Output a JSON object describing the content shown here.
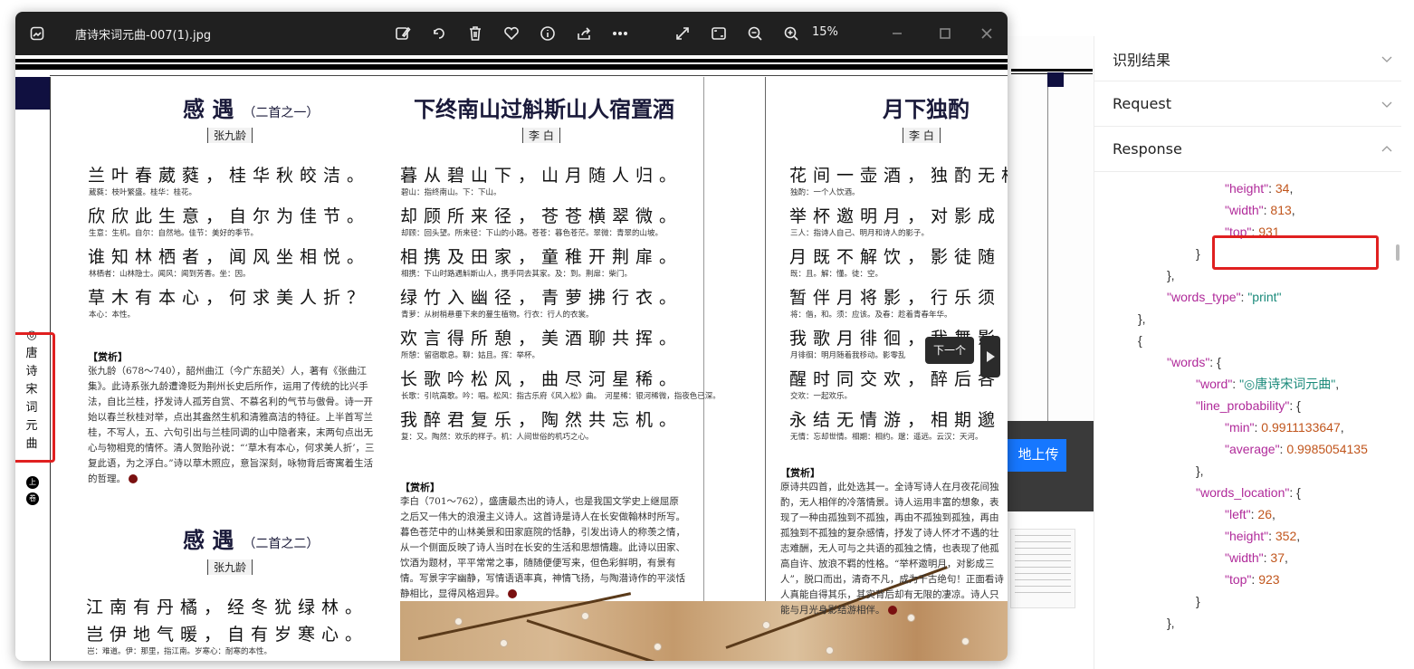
{
  "viewer": {
    "title": "唐诗宋词元曲-007(1).jpg",
    "zoom": "15%",
    "toolbar_icons": [
      "edit-image-icon",
      "rotate-icon",
      "delete-icon",
      "favorite-icon",
      "info-icon",
      "share-icon",
      "more-icon",
      "expand-icon",
      "fit-screen-icon",
      "zoom-out-icon",
      "zoom-in-icon"
    ],
    "tooltip": "下一个"
  },
  "page": {
    "side_label": [
      "◎",
      "唐",
      "诗",
      "宋",
      "词",
      "元",
      "曲"
    ],
    "side_tags": [
      "上",
      "卷"
    ],
    "poem1": {
      "title": "感 遇",
      "subtitle": "（二首之一）",
      "poet": "张九龄",
      "lines": [
        {
          "text": "兰叶春葳蕤，桂华秋皎洁。",
          "note": "葳蕤：枝叶繁盛。桂华：桂花。"
        },
        {
          "text": "欣欣此生意，自尔为佳节。",
          "note": "生意：生机。自尔：自然地。佳节：美好的季节。"
        },
        {
          "text": "谁知林栖者，闻风坐相悦。",
          "note": "林栖者：山林隐士。闻风：闻到芳香。坐：因。"
        },
        {
          "text": "草木有本心，何求美人折？",
          "note": "本心：本性。"
        }
      ],
      "analysis_heading": "【赏析】",
      "analysis": "张九龄（678～740），韶州曲江（今广东韶关）人，著有《张曲江集》。此诗系张九龄遭谗贬为荆州长史后所作，运用了传统的比兴手法，自比兰桂，抒发诗人孤芳自赏、不慕名利的气节与傲骨。诗一开始以春兰秋桂对举，点出其盎然生机和清雅高洁的特征。上半首写兰桂，不写人，五、六句引出与兰桂同调的山中隐者来，末两句点出无心与物相竞的情怀。清人贺贻孙说：“‘草木有本心，何求美人折’，三复此语，为之浮白。”诗以草木照应，意旨深刻，咏物背后寄寓着生活的哲理。"
    },
    "poem2": {
      "title": "感 遇",
      "subtitle": "（二首之二）",
      "poet": "张九龄",
      "lines": [
        {
          "text": "江南有丹橘，经冬犹绿林。",
          "note": ""
        },
        {
          "text": "岂伊地气暖，自有岁寒心。",
          "note": "岂：难道。伊：那里，指江南。岁寒心：耐寒的本性。"
        }
      ]
    },
    "poem3": {
      "title": "下终南山过斛斯山人宿置酒",
      "poet": "李 白",
      "lines": [
        {
          "text": "暮从碧山下，山月随人归。",
          "note": "碧山：指终南山。下：下山。"
        },
        {
          "text": "却顾所来径，苍苍横翠微。",
          "note": "却顾：回头望。所来径：下山的小路。苍苍：暮色苍茫。翠微：青翠的山坡。"
        },
        {
          "text": "相携及田家，童稚开荆扉。",
          "note": "相携：下山时路遇斛斯山人，携手同去其家。及：到。荆扉：柴门。"
        },
        {
          "text": "绿竹入幽径，青萝拂行衣。",
          "note": "青萝：从树梢悬垂下来的蔓生植物。行衣：行人的衣裳。"
        },
        {
          "text": "欢言得所憩，美酒聊共挥。",
          "note": "所憩：留宿歇息。聊：姑且。挥：举杯。"
        },
        {
          "text": "长歌吟松风，曲尽河星稀。",
          "note": "长歌：引吭高歌。吟：唱。松风：指古乐府《风入松》曲。　河星稀：银河稀微，指夜色已深。"
        },
        {
          "text": "我醉君复乐，陶然共忘机。",
          "note": "复：又。陶然：欢乐的样子。机：人间世俗的机巧之心。"
        }
      ],
      "analysis_heading": "【赏析】",
      "analysis": "李白（701～762），盛唐最杰出的诗人，也是我国文学史上继屈原之后又一伟大的浪漫主义诗人。这首诗是诗人在长安做翰林时所写。暮色苍茫中的山林美景和田家庭院的恬静，引发出诗人的称羡之情，从一个侧面反映了诗人当时在长安的生活和思想情趣。此诗以田家、饮酒为题材，平平常常之事，随随便便写来，但色彩鲜明，有景有情。写景字字幽静，写情语语率真，神情飞扬，与陶潜诗作的平淡恬静相比，显得风格迥异。"
    },
    "poem4": {
      "title": "月下独酌",
      "poet": "李 白",
      "lines": [
        {
          "text": "花间一壶酒，独酌无相",
          "note": "独酌：一个人饮酒。"
        },
        {
          "text": "举杯邀明月，对影成",
          "note": "三人：指诗人自己、明月和诗人的影子。"
        },
        {
          "text": "月既不解饮，影徒随",
          "note": "既：且。解：懂。徒：空。"
        },
        {
          "text": "暂伴月将影，行乐须",
          "note": "将：偕，和。须：应该。及春：趁着青春年华。"
        },
        {
          "text": "我歌月徘徊，我舞影",
          "note": "月徘徊：明月随着我移动。影零乱"
        },
        {
          "text": "醒时同交欢，醉后各",
          "note": "交欢：一起欢乐。"
        },
        {
          "text": "永结无情游，相期邈",
          "note": "无情：忘却世情。相期：相约。邈：遥远。云汉：天河。"
        }
      ],
      "analysis_heading": "【赏析】",
      "analysis": "原诗共四首，此处选其一。全诗写诗人在月夜花间独酌，无人相伴的冷落情景。诗人运用丰富的想象，表现了一种由孤独到不孤独，再由不孤独到孤独，再由孤独到不孤独的复杂感情，抒发了诗人怀才不遇的壮志难酬，无人可与之共语的孤独之情，也表现了他孤高自许、放浪不羁的性格。“举杯邀明月，对影成三人”，脱口而出，清奇不凡，成为千古绝句！正面看诗人真能自得其乐，其实背后却有无限的凄凉。诗人只能与月光身影结游相伴。"
    }
  },
  "right_app": {
    "upload_label": "地上传",
    "sections": [
      {
        "label": "识别结果",
        "expanded": false
      },
      {
        "label": "Request",
        "expanded": false
      },
      {
        "label": "Response",
        "expanded": true
      }
    ],
    "json_lines": [
      {
        "indent": 3,
        "key": "\"height\"",
        "value": "34",
        "type": "num",
        "tail": ","
      },
      {
        "indent": 3,
        "key": "\"width\"",
        "value": "813",
        "type": "num",
        "tail": ","
      },
      {
        "indent": 3,
        "key": "\"top\"",
        "value": "931",
        "type": "num",
        "tail": ""
      },
      {
        "indent": 2,
        "plain": "}"
      },
      {
        "indent": 1,
        "plain": "},"
      },
      {
        "indent": 1,
        "key": "\"words_type\"",
        "value": "\"print\"",
        "type": "str",
        "tail": ""
      },
      {
        "indent": 0,
        "plain": "},"
      },
      {
        "indent": 0,
        "plain": "{"
      },
      {
        "indent": 1,
        "key": "\"words\"",
        "value": "{",
        "type": "plain",
        "tail": ""
      },
      {
        "indent": 2,
        "key": "\"word\"",
        "value": "\"◎唐诗宋词元曲\"",
        "type": "str",
        "tail": ","
      },
      {
        "indent": 2,
        "key": "\"line_probability\"",
        "value": "{",
        "type": "plain",
        "tail": ""
      },
      {
        "indent": 3,
        "key": "\"min\"",
        "value": "0.9911133647",
        "type": "num",
        "tail": ","
      },
      {
        "indent": 3,
        "key": "\"average\"",
        "value": "0.9985054135",
        "type": "num",
        "tail": ""
      },
      {
        "indent": 2,
        "plain": "},"
      },
      {
        "indent": 2,
        "key": "\"words_location\"",
        "value": "{",
        "type": "plain",
        "tail": ""
      },
      {
        "indent": 3,
        "key": "\"left\"",
        "value": "26",
        "type": "num",
        "tail": ","
      },
      {
        "indent": 3,
        "key": "\"height\"",
        "value": "352",
        "type": "num",
        "tail": ","
      },
      {
        "indent": 3,
        "key": "\"width\"",
        "value": "37",
        "type": "num",
        "tail": ","
      },
      {
        "indent": 3,
        "key": "\"top\"",
        "value": "923",
        "type": "num",
        "tail": ""
      },
      {
        "indent": 2,
        "plain": "}"
      },
      {
        "indent": 1,
        "plain": "},"
      }
    ]
  },
  "colors": {
    "highlight": "#e02020",
    "upload_button": "#1677ff",
    "json_key": "#b02a9a",
    "json_number": "#c1561d",
    "json_string": "#1a8a7a"
  }
}
